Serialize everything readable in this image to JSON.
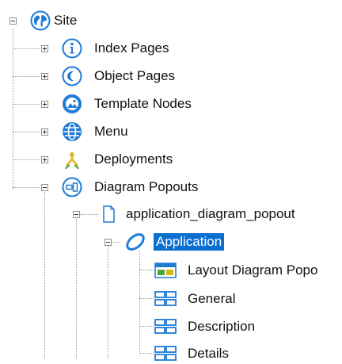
{
  "tree": {
    "root": {
      "label": "Site",
      "icon": "globe-icon",
      "expanded": true
    },
    "children": [
      {
        "label": "Index Pages",
        "icon": "info-icon",
        "expanded": false
      },
      {
        "label": "Object Pages",
        "icon": "object-page-icon",
        "expanded": false
      },
      {
        "label": "Template Nodes",
        "icon": "template-nodes-icon",
        "expanded": false
      },
      {
        "label": "Menu",
        "icon": "menu-icon",
        "expanded": false
      },
      {
        "label": "Deployments",
        "icon": "deployments-icon",
        "expanded": false
      },
      {
        "label": "Diagram Popouts",
        "icon": "diagram-popout-icon",
        "expanded": true
      }
    ],
    "popout": {
      "label": "application_diagram_popout",
      "icon": "document-icon",
      "expanded": true
    },
    "selected_node": {
      "label": "Application",
      "icon": "ellipse-shape-icon",
      "expanded": true
    },
    "leaves": [
      {
        "label": "Layout Diagram Popo",
        "icon": "layout-icon"
      },
      {
        "label": "General",
        "icon": "panel-grid-icon"
      },
      {
        "label": "Description",
        "icon": "panel-grid-icon"
      },
      {
        "label": "Details",
        "icon": "panel-grid-icon"
      }
    ]
  },
  "colors": {
    "selection": "#0a6fd1",
    "icon_blue": "#1f7bd6",
    "deploy_yellow": "#d8b41b",
    "deploy_green": "#4aa53a",
    "connector": "#9a9a9a"
  }
}
